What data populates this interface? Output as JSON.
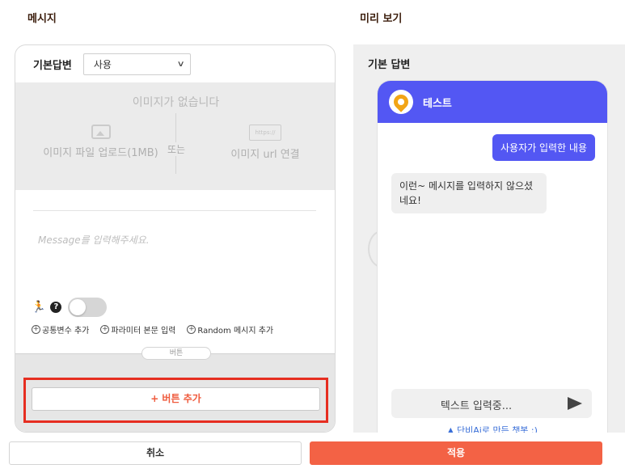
{
  "sections": {
    "message_title": "메시지",
    "preview_title": "미리 보기"
  },
  "editor": {
    "default_reply_label": "기본답변",
    "select_value": "사용",
    "no_image_text": "이미지가 없습니다",
    "upload_file_label": "이미지 파일 업로드(1MB)",
    "or_text": "또는",
    "url_icon_text": "https://",
    "url_link_label": "이미지 url 연결",
    "message_placeholder": "Message를 입력해주세요.",
    "help_icon_text": "?",
    "links": {
      "common_var": "공통변수 추가",
      "param_body": "파라미터 본문 입력",
      "random_msg": "Random 메시지 추가"
    },
    "button_tab": "버튼",
    "add_button_label": "+ 버튼 추가"
  },
  "preview": {
    "section_label": "기본 답변",
    "bot_name": "테스트",
    "user_message": "사용자가 입력한 내용",
    "bot_message": "이런~ 메시지를 입력하지 않으셨네요!",
    "input_placeholder": "텍스트 입력중...",
    "footer_note": "▲ 단비Ai로 만든 챗봇 :)"
  },
  "actions": {
    "cancel": "취소",
    "apply": "적용"
  },
  "colors": {
    "accent": "#f36245",
    "chat_header": "#5357f3",
    "highlight_border": "#e62e21"
  }
}
